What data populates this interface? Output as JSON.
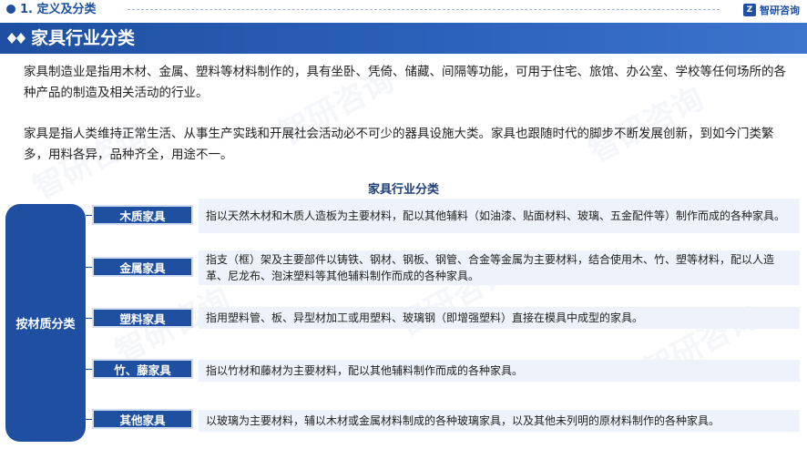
{
  "header": {
    "section_title": "1. 定义及分类",
    "logo_text": "智研咨询",
    "logo_mark": "Z"
  },
  "banner": {
    "title": "家具行业分类",
    "icon": "double-diamond-icon"
  },
  "intro": {
    "p1": "家具制造业是指用木材、金属、塑料等材料制作的，具有坐卧、凭倚、储藏、间隔等功能，可用于住宅、旅馆、办公室、学校等任何场所的各种产品的制造及相关活动的行业。",
    "p2": "家具是指人类维持正常生活、从事生产实践和开展社会活动必不可少的器具设施大类。家具也跟随时代的脚步不断发展创新，到如今门类繁多，用料各异，品种齐全，用途不一。"
  },
  "watermark": "智研咨询",
  "classification": {
    "title": "家具行业分类",
    "group_label": "按材质分类",
    "items": [
      {
        "name": "木质家具",
        "description": "指以天然木材和木质人造板为主要材料，配以其他辅料（如油漆、贴面材料、玻璃、五金配件等）制作而成的各种家具。"
      },
      {
        "name": "金属家具",
        "description": "指支（框）架及主要部件以铸铁、钢材、钢板、钢管、合金等金属为主要材料，结合使用木、竹、塑等材料，配以人造革、尼龙布、泡沫塑料等其他辅料制作而成的各种家具。"
      },
      {
        "name": "塑料家具",
        "description": "指用塑料管、板、异型材加工或用塑料、玻璃钢（即增强塑料）直接在模具中成型的家具。"
      },
      {
        "name": "竹、藤家具",
        "description": "指以竹材和藤材为主要材料，配以其他辅料制作而成的各种家具。"
      },
      {
        "name": "其他家具",
        "description": "以玻璃为主要材料，辅以木材或金属材料制成的各种玻璃家具，以及其他未列明的原材料制作的各种家具。"
      }
    ]
  },
  "colors": {
    "primary": "#1e4fa0",
    "description_bg": "#eef3fb"
  }
}
